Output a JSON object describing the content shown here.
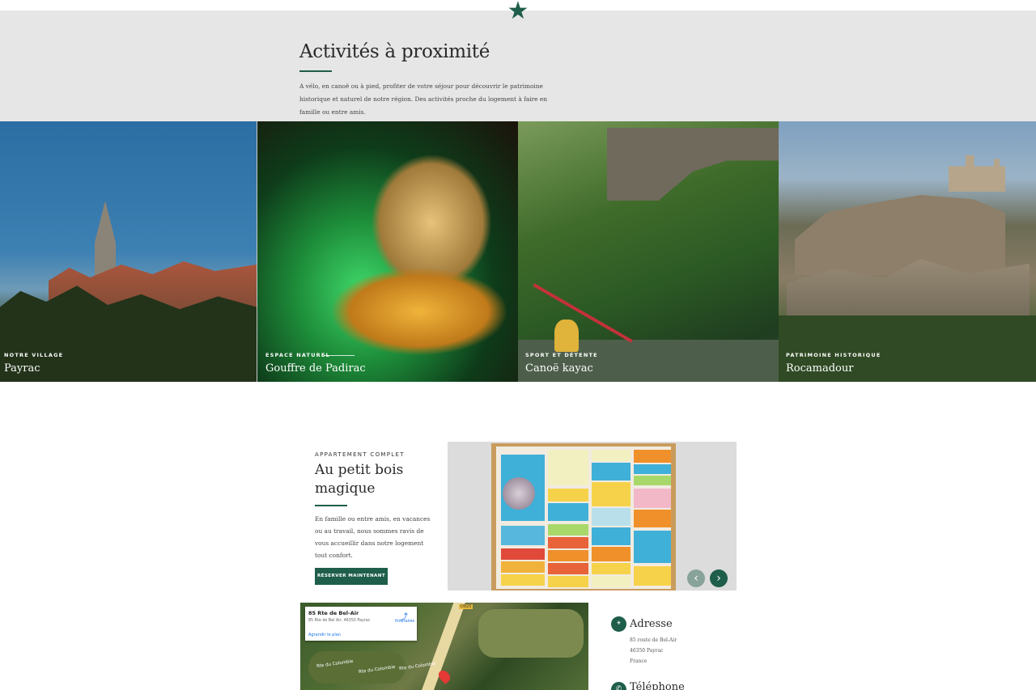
{
  "brand": {
    "accent": "#1e5e4a",
    "star_icon": "star-icon"
  },
  "intro": {
    "title": "Activités à proximité",
    "text": "A vélo, en canoë ou à pied, profiter de votre séjour pour découvrir le patrimoine historique et naturel de notre région. Des activités proche du logement à faire en famille ou entre amis."
  },
  "gallery": [
    {
      "tag": "NOTRE VILLAGE",
      "title": "Payrac"
    },
    {
      "tag": "ESPACE NATUREL",
      "title": "Gouffre de Padirac"
    },
    {
      "tag": "SPORT ET DÉTENTE",
      "title": "Canoë kayac"
    },
    {
      "tag": "PATRIMOINE HISTORIQUE",
      "title": "Rocamadour"
    }
  ],
  "card": {
    "tag": "APPARTEMENT COMPLET",
    "title": "Au petit bois magique",
    "text": "En famille ou entre amis, en vacances ou au travail, nous sommes ravis de vous accueillir dans notre logement tout confort.",
    "button": "RÉSERVER MAINTENANT"
  },
  "carousel": {
    "prev_icon": "‹",
    "next_icon": "›"
  },
  "map": {
    "address": "85 Rte de Bel-Air",
    "subaddress": "85 Rte de Bel Air, 46350 Payrac",
    "route_label": "Itinéraires",
    "enlarge_label": "Agrandir le plan",
    "road_label": "Rte du Colombie",
    "road_label_2": "Rte du Colombie",
    "road_label_3": "Rte du Colombie",
    "shield": "D820"
  },
  "contact": {
    "address_title": "Adresse",
    "address_lines": [
      "85 route de Bel-Air",
      "46350 Payrac",
      "France"
    ],
    "phone_title": "Téléphone"
  }
}
